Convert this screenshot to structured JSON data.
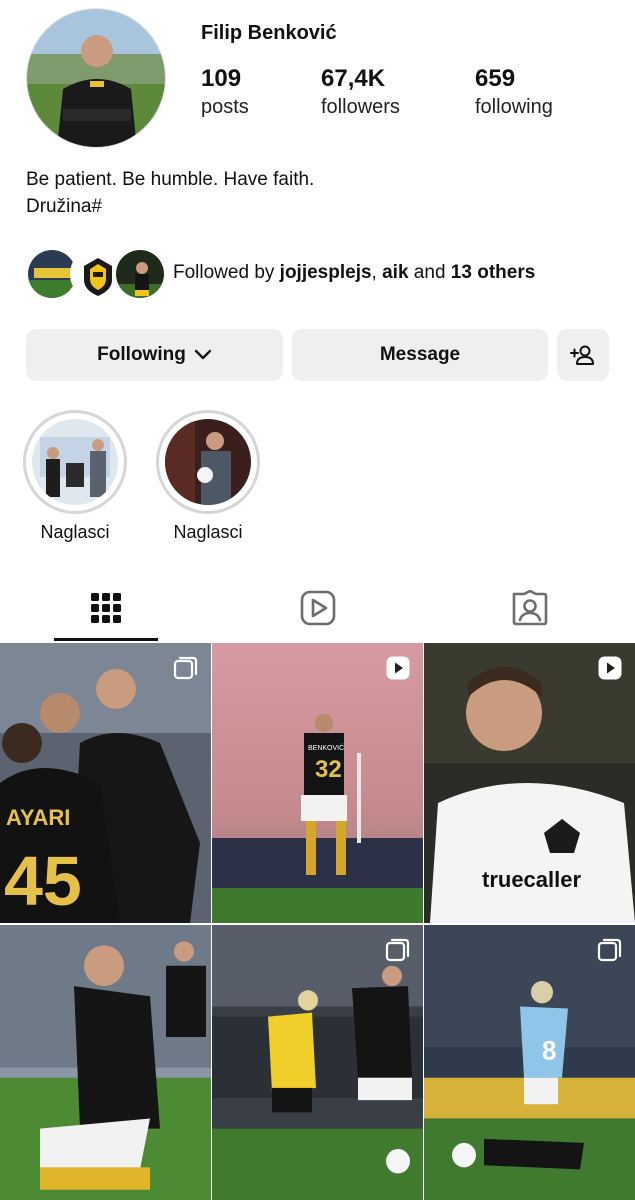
{
  "profile": {
    "name": "Filip Benković",
    "stats": [
      {
        "num": "109",
        "label": "posts"
      },
      {
        "num": "67,4K",
        "label": "followers"
      },
      {
        "num": "659",
        "label": "following"
      }
    ],
    "bio_line1": "Be patient. Be humble. Have faith.",
    "bio_line2": "Družina#"
  },
  "mutual": {
    "prefix": "Followed by ",
    "user1": "jojjesplejs",
    "sep": ", ",
    "user2": "aik",
    "and": " and ",
    "others": "13 others"
  },
  "actions": {
    "following_label": "Following",
    "message_label": "Message"
  },
  "highlights": [
    {
      "label": "Naglasci"
    },
    {
      "label": "Naglasci"
    }
  ],
  "tabs": [
    {
      "name": "posts-grid-icon"
    },
    {
      "name": "reels-icon"
    },
    {
      "name": "tagged-icon"
    }
  ],
  "posts": [
    {
      "badge": "carousel-icon",
      "number_text": "45",
      "name_text": "AYARI"
    },
    {
      "badge": "reel-icon",
      "number_text": "32",
      "name_text": "BENKOVIĆ"
    },
    {
      "badge": "reel-icon",
      "number_text": "truecaller",
      "name_text": ""
    },
    {
      "badge": "none",
      "number_text": "",
      "name_text": ""
    },
    {
      "badge": "carousel-icon",
      "number_text": "",
      "name_text": ""
    },
    {
      "badge": "carousel-icon",
      "number_text": "8",
      "name_text": ""
    }
  ],
  "colors": {
    "button_bg": "#efefef",
    "aik_black": "#141414",
    "aik_yellow": "#f2c418",
    "pitch_green": "#3f7d2e",
    "sky_blue": "#8ec5e8"
  }
}
